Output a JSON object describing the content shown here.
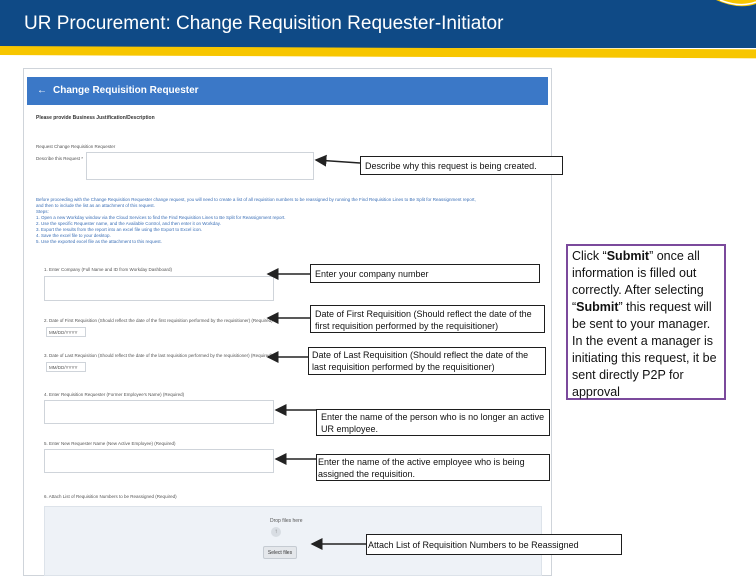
{
  "slide": {
    "title": "UR Procurement: Change Requisition Requester-Initiator"
  },
  "form": {
    "header_title": "Change Requisition Requester",
    "back_icon": "arrow-left-icon",
    "section_label": "Please provide Business Justification/Description",
    "sub_label": "Request Change Requisition Requester",
    "describe_label": "Describe this Request *",
    "instructions_lines": [
      "Before proceeding with the Change Requisition Requester change request, you will need to create a list of all requisition numbers to be reassigned by running the Find Requisition Lines to Be Split for Reassignment report,",
      "and then to include the list as an attachment of this request.",
      "Steps:",
      "1. Open a new Workday window via the Cloud Services to find the Find Requisition Lines to Be Split for Reassignment report.",
      "2. Use the specific Requester name, and the Available Control, and then enter it on Workday.",
      "3. Export the results from the report into an excel file using the Export to Excel icon.",
      "4. Save the excel file to your desktop.",
      "5. Use the exported excel file as the attachment to this request."
    ],
    "company_label": "1. Enter Company (Full Name and ID from Workday Dashboard)",
    "first_req_label": "2. Date of First Requisition (Should reflect the date of the first requisition performed by the requisitioner) (Required)",
    "last_req_label": "3. Date of Last Requisition (Should reflect the date of the last requisition performed by the requisitioner) (Required)",
    "date_placeholder": "MM/DD/YYYY",
    "former_employee_label": "4. Enter Requisition Requester (Former Employee's Name) (Required)",
    "new_employee_label": "5. Enter New Requester Name (New Active Employee) (Required)",
    "attach_label": "6. Attach List of Requisition Numbers to be Reassigned (Required)",
    "upload_text": "Drop files here",
    "upload_icon": "upload-icon",
    "select_files": "Select files"
  },
  "callouts": {
    "describe": "Describe why this request is being created.",
    "company": "Enter your company number",
    "first_req": "Date of First Requisition (Should reflect the date of the first requisition performed by the requisitioner)",
    "last_req": "Date of Last Requisition (Should reflect the date of the last requisition performed by the requisitioner)",
    "former_employee": "Enter the name of the person who is no longer an active UR employee.",
    "new_employee": "Enter the name of the active employee who is being assigned the requisition.",
    "attach": "Attach List of Requisition Numbers to be Reassigned",
    "submit_prefix": "Click “",
    "submit_bold": "Submit",
    "submit_middle": "” once all information is filled out correctly. After selecting “",
    "submit_bold2": "Submit",
    "submit_suffix": "” this request will be sent to your manager. In the event a manager is initiating this request, it be sent directly P2P for approval"
  },
  "colors": {
    "title_bar": "#0f4a86",
    "accent_stripe": "#f7c600",
    "form_header": "#3b78c7",
    "callout_border": "#7b4a9c"
  }
}
